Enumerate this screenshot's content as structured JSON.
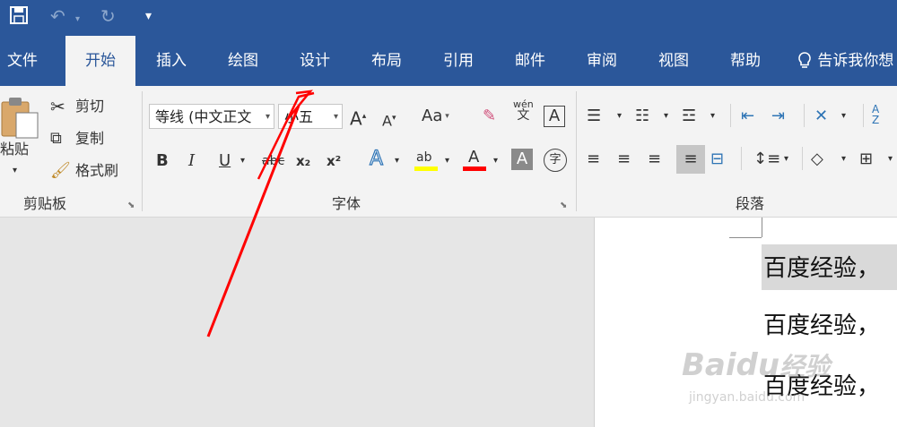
{
  "quick_access": {
    "save_icon": "save-icon",
    "undo_icon": "undo-icon",
    "redo_icon": "redo-icon",
    "customize_icon": "customize-qat-icon"
  },
  "tabs": [
    {
      "label": "文件"
    },
    {
      "label": "开始",
      "active": true
    },
    {
      "label": "插入"
    },
    {
      "label": "绘图"
    },
    {
      "label": "设计"
    },
    {
      "label": "布局"
    },
    {
      "label": "引用"
    },
    {
      "label": "邮件"
    },
    {
      "label": "审阅"
    },
    {
      "label": "视图"
    },
    {
      "label": "帮助"
    }
  ],
  "tell_me": {
    "label": "告诉我你想",
    "icon": "lightbulb-icon"
  },
  "clipboard": {
    "group_label": "剪贴板",
    "paste_label": "粘贴",
    "cut_label": "剪切",
    "copy_label": "复制",
    "format_painter_label": "格式刷"
  },
  "font": {
    "group_label": "字体",
    "font_name": "等线 (中文正文",
    "font_size": "小五",
    "grow_label": "A",
    "shrink_label": "A",
    "change_case_label": "Aa",
    "phonetic_top": "wén",
    "phonetic_bottom": "文",
    "char_border": "A",
    "bold": "B",
    "italic": "I",
    "underline": "U",
    "strike": "abc",
    "subscript": "x₂",
    "superscript": "x²",
    "text_effects": "A",
    "highlight": "ab",
    "font_color": "A",
    "char_shading": "A",
    "enclose_char": "字"
  },
  "paragraph": {
    "group_label": "段落"
  },
  "document": {
    "lines": [
      "百度经验，",
      "百度经验，",
      "百度经验，"
    ]
  },
  "watermark": {
    "brand": "Baidu",
    "brand_cn": "经验",
    "url": "jingyan.baidu.com"
  },
  "colors": {
    "title_bar": "#2b579a",
    "ribbon": "#f3f3f3",
    "highlight_yellow": "#ffff00",
    "font_red": "#ff0000",
    "annotation_arrow": "#ff0000"
  }
}
